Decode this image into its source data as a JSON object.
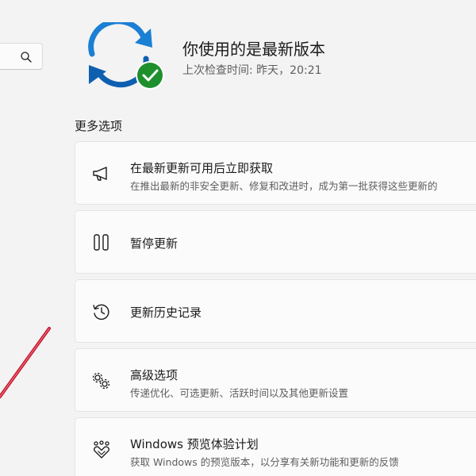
{
  "search": {
    "icon": "search-icon"
  },
  "status": {
    "title": "你使用的是最新版本",
    "last_checked": "上次检查时间: 昨天，20:21",
    "icon": "sync-check-icon",
    "accent": "#0f6cbd",
    "check_color": "#107c10"
  },
  "more_options": {
    "title": "更多选项",
    "items": [
      {
        "title": "在最新更新可用后立即获取",
        "description": "在推出最新的非安全更新、修复和改进时，成为第一批获得这些更新的",
        "icon": "megaphone-icon"
      },
      {
        "title": "暂停更新",
        "icon": "pause-icon"
      },
      {
        "title": "更新历史记录",
        "icon": "history-icon"
      },
      {
        "title": "高级选项",
        "description": "传递优化、可选更新、活跃时间以及其他更新设置",
        "icon": "gears-icon"
      },
      {
        "title": "Windows 预览体验计划",
        "description": "获取 Windows 的预览版本，以分享有关新功能和更新的反馈",
        "icon": "insider-hearts-icon"
      }
    ]
  },
  "annotation": {
    "color": "#c8102e"
  }
}
